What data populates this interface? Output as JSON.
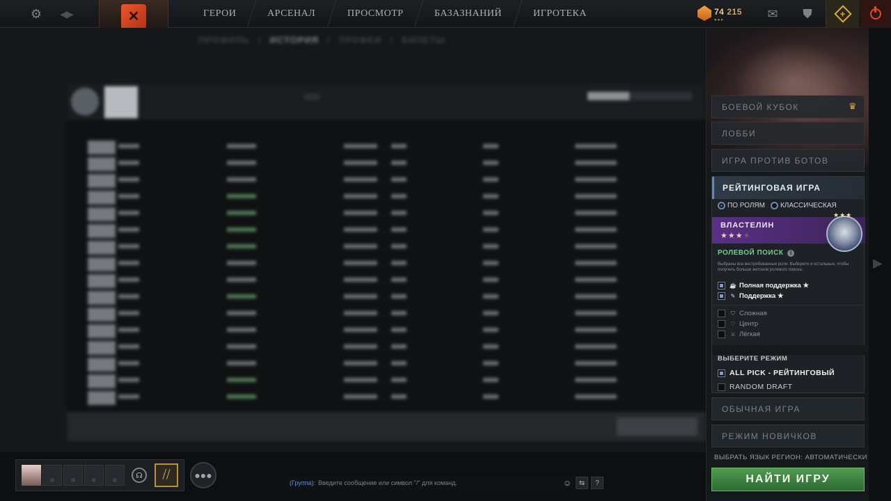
{
  "topbar": {
    "nav": [
      "ГЕРОИ",
      "АРСЕНАЛ",
      "ПРОСМОТР",
      "БАЗАЗНАНИЙ",
      "ИГРОТЕКА"
    ],
    "currency_primary": "74",
    "currency_secondary": "215",
    "currency_dots": "●●●"
  },
  "profile": {
    "subtabs": [
      "ПРОФИЛЬ",
      "/",
      "ИСТОРИЯ",
      "/",
      "ТРОФЕИ",
      "/",
      "БИЛЕТЫ"
    ]
  },
  "right_panel": {
    "battle_cup": "БОЕВОЙ КУБОК",
    "lobby": "ЛОББИ",
    "vs_bots": "ИГРА ПРОТИВ БОТОВ",
    "ranked_title": "РЕЙТИНГОВАЯ ИГРА",
    "by_roles": "ПО РОЛЯМ",
    "classic": "КЛАССИЧЕСКАЯ",
    "rank_name": "ВЛАСТЕЛИН",
    "rank_stars": "★★★",
    "rank_star_dim": "★",
    "role_search": "РОЛЕВОЙ ПОИСК",
    "role_desc": "Выбраны все востребованные роли. Выберите и остальные, чтобы получить больше жетонов ролевого поиска.",
    "roles": [
      {
        "label": "Полная поддержка",
        "star": "★",
        "selected": true
      },
      {
        "label": "Поддержка",
        "star": "★",
        "selected": true
      },
      {
        "label": "Сложная",
        "star": "",
        "selected": false
      },
      {
        "label": "Центр",
        "star": "",
        "selected": false
      },
      {
        "label": "Лёгкая",
        "star": "",
        "selected": false
      }
    ],
    "choose_mode": "ВЫБЕРИТЕ РЕЖИМ",
    "modes": [
      {
        "label": "ALL PICK - РЕЙТИНГОВЫЙ",
        "selected": true
      },
      {
        "label": "RANDOM DRAFT",
        "selected": false
      }
    ],
    "normal_game": "ОБЫЧНАЯ ИГРА",
    "newbie_mode": "РЕЖИМ НОВИЧКОВ",
    "choose_language": "ВЫБРАТЬ ЯЗЫК",
    "region": "РЕГИОН: АВТОМАТИЧЕСКИ",
    "find_game": "НАЙТИ ИГРУ"
  },
  "chat": {
    "channel": "(Группа):",
    "placeholder": "Введите сообщение или символ \"/\" для команд."
  },
  "colors": {
    "accent_green": "#4f9b4f",
    "ranked_purple": "#5b2f86",
    "role_search_green": "#6ed08a",
    "channel_blue": "#6b8fc4"
  }
}
